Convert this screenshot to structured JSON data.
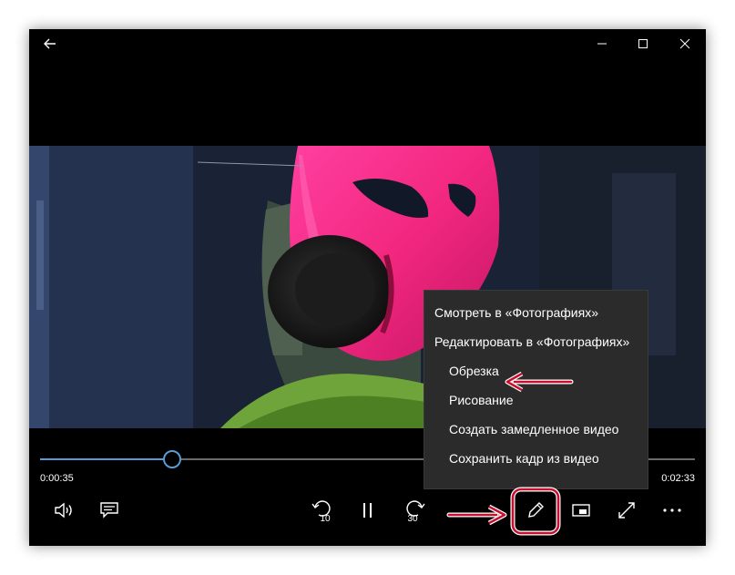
{
  "window": {
    "back_icon": "arrow-left-icon",
    "minimize_icon": "minimize-icon",
    "maximize_icon": "maximize-icon",
    "close_icon": "close-icon"
  },
  "player": {
    "current_time": "0:00:35",
    "total_time": "0:02:33",
    "progress": 0.2,
    "accent_color": "#5b9bd5",
    "skip_back_label": "10",
    "skip_forward_label": "30"
  },
  "context_menu": {
    "items": [
      {
        "label": "Смотреть в «Фотографиях»"
      },
      {
        "label": "Редактировать в «Фотографиях»"
      },
      {
        "label": "Обрезка"
      },
      {
        "label": "Рисование"
      },
      {
        "label": "Создать замедленное видео"
      },
      {
        "label": "Сохранить кадр из видео"
      }
    ]
  },
  "annotations": {
    "highlight_color": "#c8102e"
  }
}
